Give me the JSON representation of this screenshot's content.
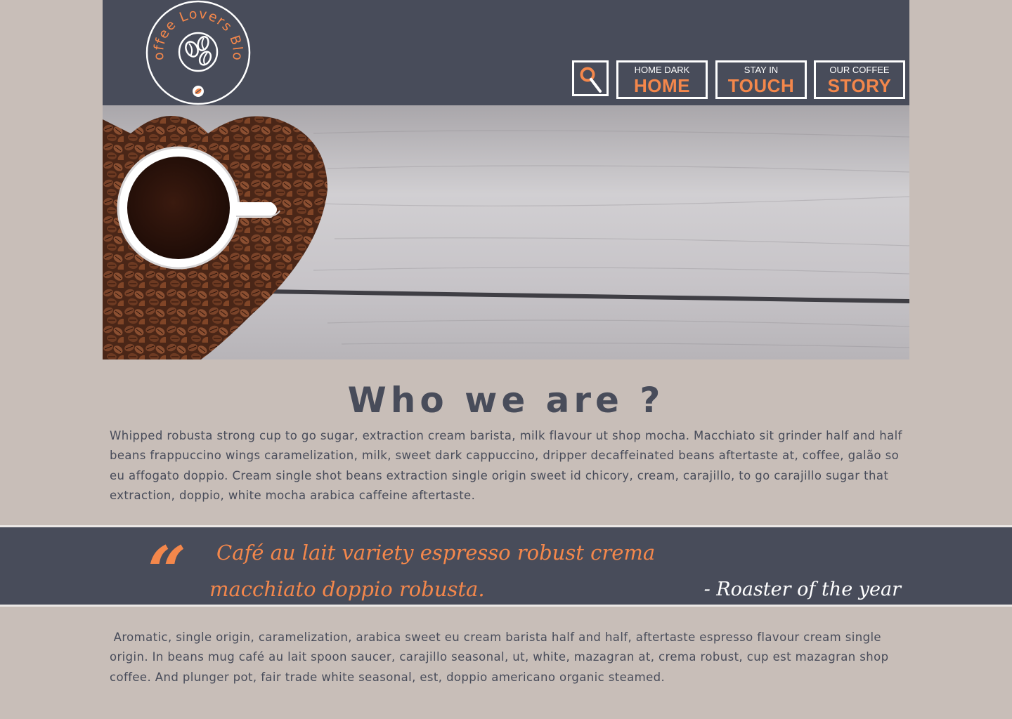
{
  "colors": {
    "background": "#c8beb8",
    "header": "#484c5a",
    "accent": "#f4874b",
    "text": "#484c5a",
    "white": "#ffffff"
  },
  "logo": {
    "text": "Coffee Lovers Blog",
    "icon": "coffee-beans-icon"
  },
  "nav": {
    "search_icon": "search-icon",
    "items": [
      {
        "small": "HOME DARK",
        "big": "HOME"
      },
      {
        "small": "STAY IN",
        "big": "TOUCH"
      },
      {
        "small": "OUR COFFEE",
        "big": "STORY"
      }
    ]
  },
  "hero": {
    "image": "coffee-cup-heart-beans-photo"
  },
  "about": {
    "heading": "Who we are ?",
    "paragraph": "Whipped robusta strong cup to go sugar, extraction cream barista, milk flavour ut shop mocha. Macchiato sit grinder half and half beans frappuccino wings caramelization, milk, sweet dark cappuccino, dripper decaffeinated beans aftertaste at, coffee, galão so eu affogato doppio. Cream single shot beans extraction single origin sweet id chicory, cream, carajillo, to go carajillo sugar that extraction, doppio, white mocha arabica caffeine aftertaste."
  },
  "quote": {
    "mark": "“",
    "line1": "Café au lait variety espresso robust crema",
    "line2": "macchiato doppio robusta.",
    "author": "- Roaster of the year"
  },
  "footer_text": {
    "paragraph": " Aromatic, single origin, caramelization, arabica sweet eu cream barista half and half, aftertaste espresso flavour cream single origin. In beans mug café au lait spoon saucer, carajillo seasonal, ut, white, mazagran at, crema robust, cup est mazagran shop coffee. And plunger pot, fair trade white seasonal, est, doppio americano organic steamed."
  }
}
